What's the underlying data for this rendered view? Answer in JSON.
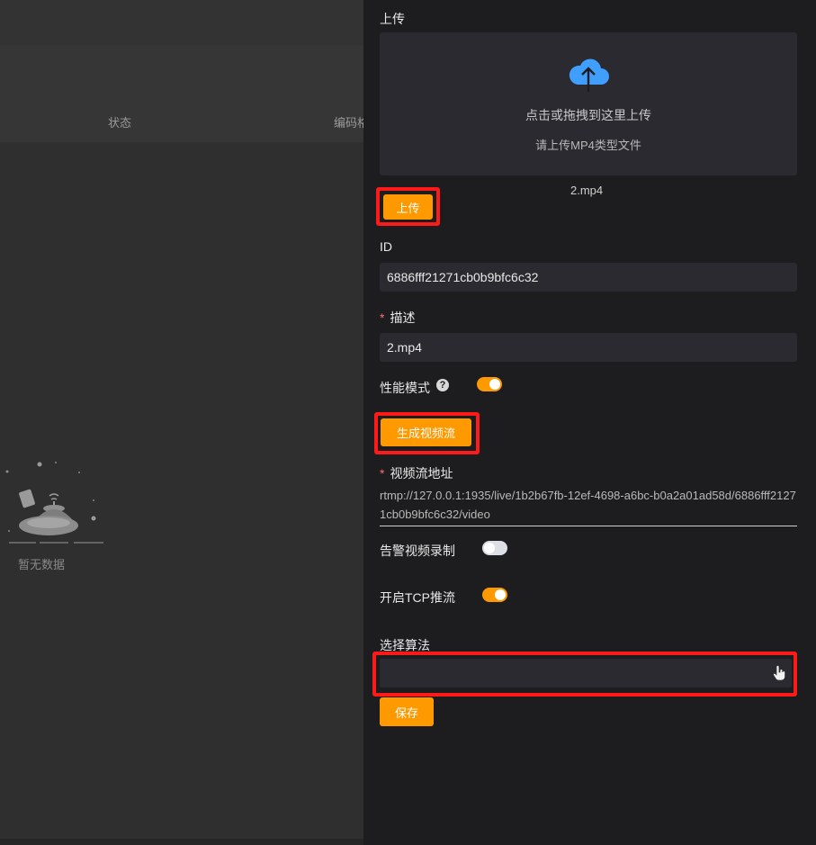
{
  "background": {
    "columns": {
      "status": "状态",
      "codec": "编码格"
    },
    "empty_text": "暂无数据"
  },
  "drawer": {
    "upload": {
      "label": "上传",
      "drop_text": "点击或拖拽到这里上传",
      "tip": "请上传MP4类型文件",
      "file_name": "2.mp4",
      "button": "上传"
    },
    "id_field": {
      "label": "ID",
      "value": "6886fff21271cb0b9bfc6c32"
    },
    "desc_field": {
      "required": "*",
      "label": "描述",
      "value": "2.mp4"
    },
    "performance_mode": {
      "label": "性能模式",
      "help": "?",
      "on": true
    },
    "generate_button": "生成视频流",
    "stream_url": {
      "required": "*",
      "label": "视频流地址",
      "value": "rtmp://127.0.0.1:1935/live/1b2b67fb-12ef-4698-a6bc-b0a2a01ad58d/6886fff21271cb0b9bfc6c32/video"
    },
    "alarm_record": {
      "label": "告警视频录制",
      "on": false
    },
    "tcp_push": {
      "label": "开启TCP推流",
      "on": true
    },
    "algorithm": {
      "label": "选择算法",
      "value": ""
    },
    "save_button": "保存"
  },
  "colors": {
    "accent": "#ff9900",
    "highlight": "#ff1a1a",
    "drawer_bg": "#1d1d1f",
    "input_bg": "#2a2a30",
    "upload_icon": "#409eff"
  }
}
